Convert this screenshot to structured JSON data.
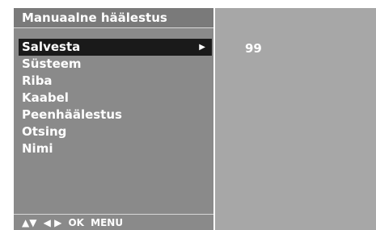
{
  "menu": {
    "title": "Manuaalne häälestus",
    "items": [
      {
        "label": "Salvesta",
        "selected": true,
        "arrow": "▶"
      },
      {
        "label": "Süsteem"
      },
      {
        "label": "Riba"
      },
      {
        "label": "Kaabel"
      },
      {
        "label": "Peenhäälestus"
      },
      {
        "label": "Otsing"
      },
      {
        "label": "Nimi"
      }
    ],
    "hints": {
      "up_down": "▲▼",
      "left_right": "◀ ▶",
      "ok": "OK",
      "menu": "MENU"
    }
  },
  "value_panel": {
    "value": "99"
  },
  "colors": {
    "left_panel": "#8a8a8a",
    "right_panel": "#a7a7a7",
    "selected_bg": "#1a1a1a",
    "text": "#ffffff"
  }
}
